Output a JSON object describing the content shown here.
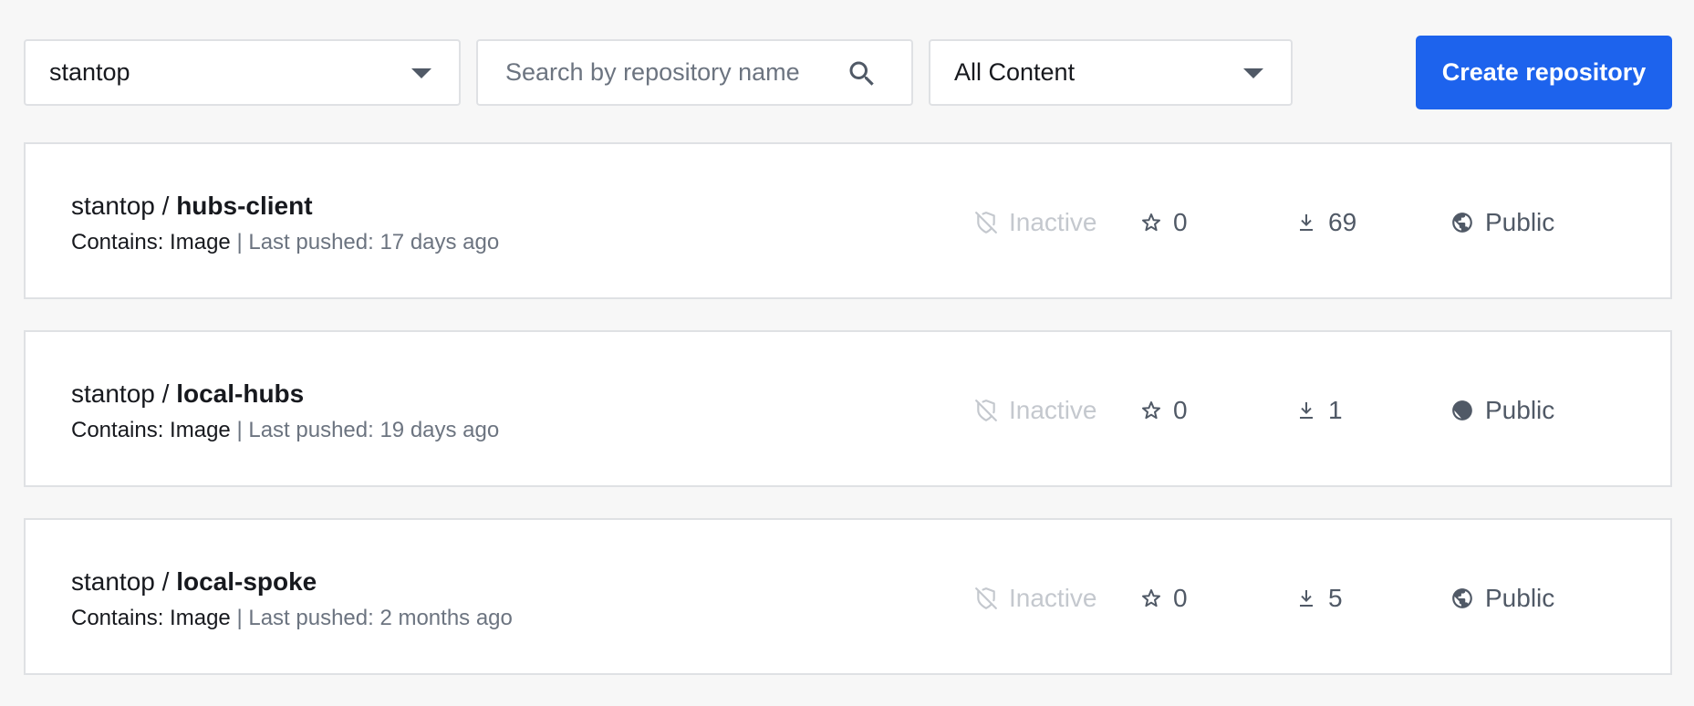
{
  "filters": {
    "namespace": "stantop",
    "search_placeholder": "Search by repository name",
    "search_value": "",
    "content_type": "All Content"
  },
  "create_button_label": "Create repository",
  "repositories": [
    {
      "namespace": "stantop",
      "separator": "/",
      "name": "hubs-client",
      "contains_label": "Contains: Image",
      "pushed_separator": "|",
      "last_pushed": "Last pushed: 17 days ago",
      "status": "Inactive",
      "stars": "0",
      "pulls": "69",
      "visibility": "Public"
    },
    {
      "namespace": "stantop",
      "separator": "/",
      "name": "local-hubs",
      "contains_label": "Contains: Image",
      "pushed_separator": "|",
      "last_pushed": "Last pushed: 19 days ago",
      "status": "Inactive",
      "stars": "0",
      "pulls": "1",
      "visibility": "Public"
    },
    {
      "namespace": "stantop",
      "separator": "/",
      "name": "local-spoke",
      "contains_label": "Contains: Image",
      "pushed_separator": "|",
      "last_pushed": "Last pushed: 2 months ago",
      "status": "Inactive",
      "stars": "0",
      "pulls": "5",
      "visibility": "Public"
    }
  ],
  "icons": {
    "inactive": "shield-off-icon",
    "stars": "star-outline-icon",
    "pulls": "download-icon",
    "visibility": "globe-icon",
    "search": "search-icon",
    "dropdown": "caret-down-icon"
  },
  "colors": {
    "accent": "#1d63ed",
    "inactive": "#c4c8ce",
    "muted_text": "#6c7480",
    "border": "#dfe1e4"
  }
}
